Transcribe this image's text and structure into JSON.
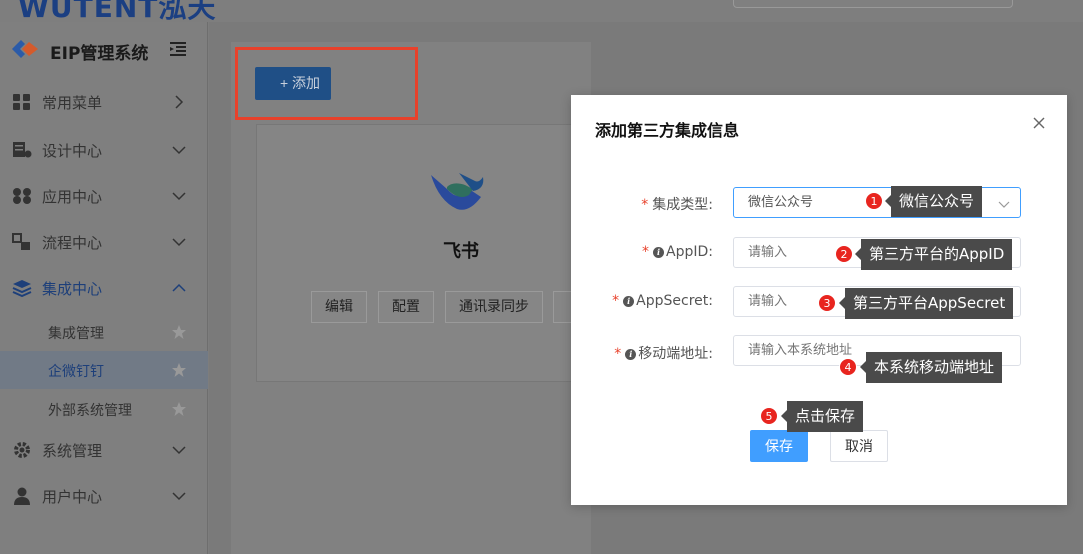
{
  "topbar": {
    "logo_text": "WUTENT泓天"
  },
  "brand": {
    "title": "EIP管理系统"
  },
  "sidebar": {
    "items": [
      {
        "label": "常用菜单",
        "icon": "grid-icon"
      },
      {
        "label": "设计中心",
        "icon": "design-icon"
      },
      {
        "label": "应用中心",
        "icon": "apps-icon"
      },
      {
        "label": "流程中心",
        "icon": "flow-icon"
      },
      {
        "label": "集成中心",
        "icon": "layers-icon"
      },
      {
        "label": "系统管理",
        "icon": "gear-icon"
      },
      {
        "label": "用户中心",
        "icon": "user-icon"
      }
    ],
    "subitems": [
      {
        "label": "集成管理"
      },
      {
        "label": "企微钉钉"
      },
      {
        "label": "外部系统管理"
      }
    ]
  },
  "main": {
    "add_label": "+ 添加",
    "card": {
      "title": "飞书",
      "buttons": [
        "编辑",
        "配置",
        "通讯录同步"
      ]
    }
  },
  "modal": {
    "title": "添加第三方集成信息",
    "fields": [
      {
        "label": "集成类型:",
        "value": "微信公众号"
      },
      {
        "label": "AppID:",
        "placeholder": "请输入"
      },
      {
        "label": "AppSecret:",
        "placeholder": "请输入"
      },
      {
        "label": "移动端地址:",
        "placeholder": "请输入本系统地址"
      }
    ],
    "save_label": "保存",
    "cancel_label": "取消"
  },
  "callouts": [
    {
      "num": "1",
      "text": "微信公众号"
    },
    {
      "num": "2",
      "text": "第三方平台的AppID"
    },
    {
      "num": "3",
      "text": "第三方平台AppSecret"
    },
    {
      "num": "4",
      "text": "本系统移动端地址"
    },
    {
      "num": "5",
      "text": "点击保存"
    }
  ],
  "colors": {
    "primary": "#409eff",
    "danger": "#e8251f",
    "highlight": "#e8412b"
  }
}
